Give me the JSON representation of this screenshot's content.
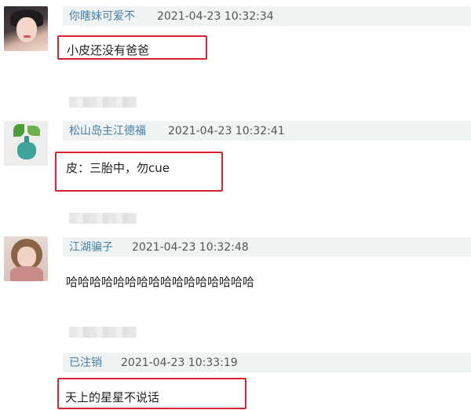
{
  "comments": [
    {
      "username": "你瞎妹可爱不",
      "timestamp": "2021-04-23 10:32:34",
      "text": "小皮还没有爸爸"
    },
    {
      "username": "松山岛主江德福",
      "timestamp": "2021-04-23 10:32:41",
      "text": "皮：三胎中，勿cue"
    },
    {
      "username": "江湖骗子",
      "timestamp": "2021-04-23 10:32:48",
      "text": "哈哈哈哈哈哈哈哈哈哈哈哈哈哈哈哈"
    },
    {
      "username": "已注销",
      "timestamp": "2021-04-23 10:33:19",
      "text": "天上的星星不说话"
    }
  ],
  "colors": {
    "username": "#4a7fa6",
    "header_background": "#eff3f3",
    "highlight_border": "#d9232e"
  }
}
